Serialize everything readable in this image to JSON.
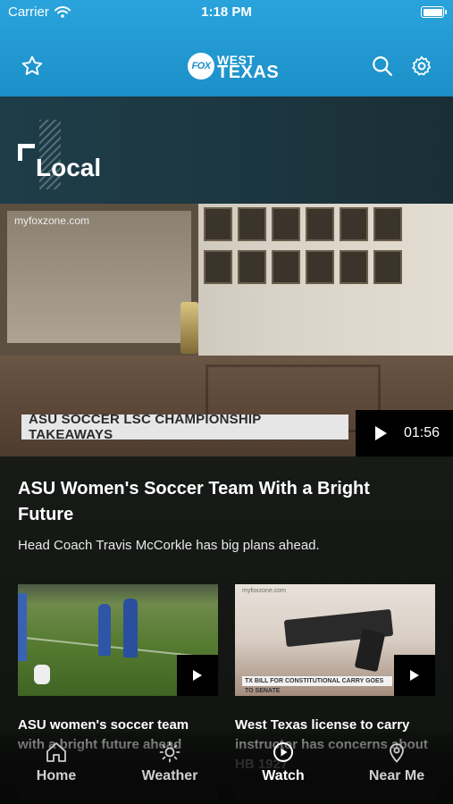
{
  "status_bar": {
    "carrier": "Carrier",
    "time": "1:18 PM"
  },
  "header": {
    "logo": {
      "badge": "FOX",
      "line1": "WEST",
      "line2": "TEXAS"
    },
    "favorite_icon": "star-icon",
    "search_icon": "search-icon",
    "settings_icon": "gear-icon"
  },
  "section": {
    "title": "Local"
  },
  "hero": {
    "watermark": "myfoxzone.com",
    "lower_third": "ASU SOCCER LSC CHAMPIONSHIP TAKEAWAYS",
    "duration": "01:56",
    "headline": "ASU Women's Soccer Team With a Bright Future",
    "dek": "Head Coach Travis McCorkle has big plans ahead."
  },
  "cards": [
    {
      "title": "ASU women's soccer team with a bright future ahead"
    },
    {
      "title": "West Texas license to carry instructor has concerns about HB 1927",
      "watermark": "myfoxzone.com",
      "chyron": "TX BILL FOR CONSTITUTIONAL CARRY GOES TO SENATE"
    }
  ],
  "tabbar": {
    "items": [
      {
        "label": "Home",
        "icon": "home-icon"
      },
      {
        "label": "Weather",
        "icon": "sun-icon"
      },
      {
        "label": "Watch",
        "icon": "play-circle-icon",
        "active": true
      },
      {
        "label": "Near Me",
        "icon": "map-pin-icon"
      }
    ]
  },
  "colors": {
    "header_blue": "#1b8fc8",
    "banner_teal": "#1d3d48",
    "active_tab": "#ffffff",
    "inactive_tab": "#cfcfcf"
  }
}
